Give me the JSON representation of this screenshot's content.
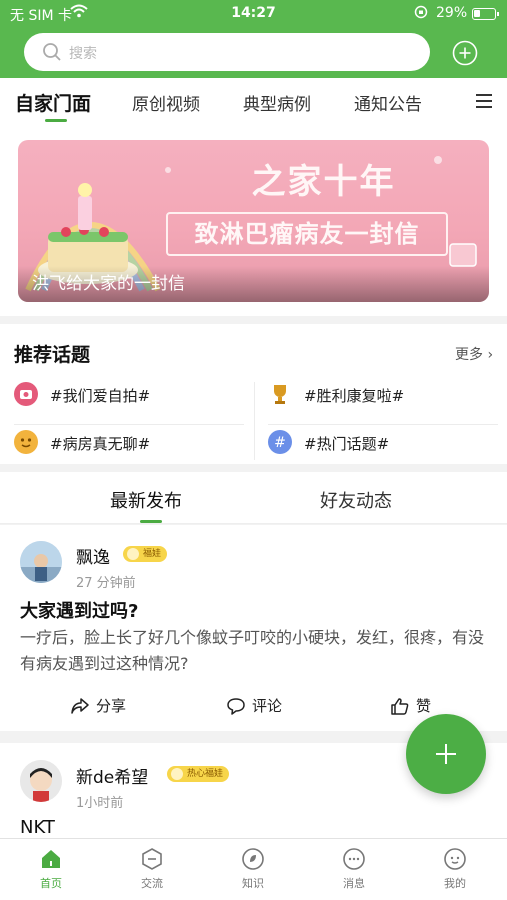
{
  "status_bar": {
    "carrier": "无 SIM 卡",
    "time": "14:27",
    "battery": "29%"
  },
  "search": {
    "placeholder": "搜索"
  },
  "tabs": [
    {
      "label": "自家门面",
      "active": true
    },
    {
      "label": "原创视频"
    },
    {
      "label": "典型病例"
    },
    {
      "label": "通知公告"
    }
  ],
  "banner": {
    "headline": "之家十年",
    "subline": "致淋巴瘤病友一封信",
    "caption": "洪飞给大家的一封信"
  },
  "topics": {
    "title": "推荐话题",
    "more": "更多",
    "items": [
      {
        "label": "#我们爱自拍#",
        "icon": "camera-icon",
        "color": "#e45a7a"
      },
      {
        "label": "#胜利康复啦#",
        "icon": "trophy-icon",
        "color": "#d99a22"
      },
      {
        "label": "#病房真无聊#",
        "icon": "emoji-icon",
        "color": "#f2b33d"
      },
      {
        "label": "#热门话题#",
        "icon": "hashtag-icon",
        "color": "#6b8fe8"
      }
    ]
  },
  "feed_tabs": [
    {
      "label": "最新发布",
      "active": true
    },
    {
      "label": "好友动态"
    }
  ],
  "posts": [
    {
      "author": "飘逸",
      "badge": "福娃",
      "time": "27 分钟前",
      "title": "大家遇到过吗?",
      "body": "一疗后，脸上长了好几个像蚊子叮咬的小硬块，发红，很疼，有没有病友遇到过这种情况?",
      "actions": {
        "share": "分享",
        "comment": "评论",
        "like": "赞"
      }
    },
    {
      "author": "新de希望",
      "badge": "热心福娃",
      "time": "1小时前",
      "title": "NKT"
    }
  ],
  "bottom_nav": [
    {
      "label": "首页",
      "icon": "home-icon",
      "active": true
    },
    {
      "label": "交流",
      "icon": "chat-icon"
    },
    {
      "label": "知识",
      "icon": "knowledge-icon"
    },
    {
      "label": "消息",
      "icon": "message-icon"
    },
    {
      "label": "我的",
      "icon": "profile-icon"
    }
  ],
  "colors": {
    "brand": "#59b84f",
    "accent": "#4bab42",
    "badge": "#f7d54a"
  }
}
